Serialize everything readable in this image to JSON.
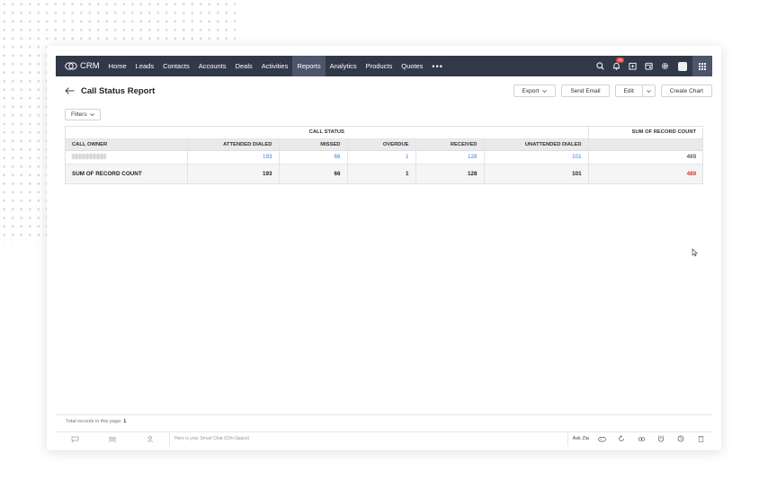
{
  "brand": {
    "name": "CRM"
  },
  "nav": {
    "items": [
      {
        "label": "Home",
        "active": false
      },
      {
        "label": "Leads",
        "active": false
      },
      {
        "label": "Contacts",
        "active": false
      },
      {
        "label": "Accounts",
        "active": false
      },
      {
        "label": "Deals",
        "active": false
      },
      {
        "label": "Activities",
        "active": false
      },
      {
        "label": "Reports",
        "active": true
      },
      {
        "label": "Analytics",
        "active": false
      },
      {
        "label": "Products",
        "active": false
      },
      {
        "label": "Quotes",
        "active": false
      }
    ],
    "more": "•••",
    "notification_count": "15",
    "icons": [
      "search-icon",
      "bell-icon",
      "calendar-add-icon",
      "calendar-icon",
      "gear-icon",
      "avatar",
      "apps-grid-icon"
    ]
  },
  "page": {
    "title": "Call Status Report",
    "export_label": "Export",
    "send_email_label": "Send Email",
    "edit_label": "Edit",
    "create_chart_label": "Create Chart",
    "filters_label": "Filters"
  },
  "report": {
    "group_header": "CALL STATUS",
    "sum_header": "SUM OF RECORD COUNT",
    "columns": [
      "CALL OWNER",
      "ATTENDED DIALED",
      "MISSED",
      "OVERDUE",
      "RECEIVED",
      "UNATTENDED DIALED"
    ],
    "rows": [
      {
        "owner": "",
        "values": [
          "193",
          "66",
          "1",
          "128",
          "101"
        ],
        "total": "489"
      }
    ],
    "summary": {
      "label": "SUM OF RECORD COUNT",
      "values": [
        "193",
        "66",
        "1",
        "128",
        "101"
      ],
      "total": "489"
    },
    "colors": {
      "link": "#3a7dd8",
      "total_highlight": "#e0352b",
      "nav_bg": "#313949"
    }
  },
  "footer": {
    "total_label": "Total records in this page:",
    "total_value": "1",
    "chat_hint": "Here is your Smart Chat (Ctrl+Space)",
    "ask_zia": "Ask Zia"
  }
}
